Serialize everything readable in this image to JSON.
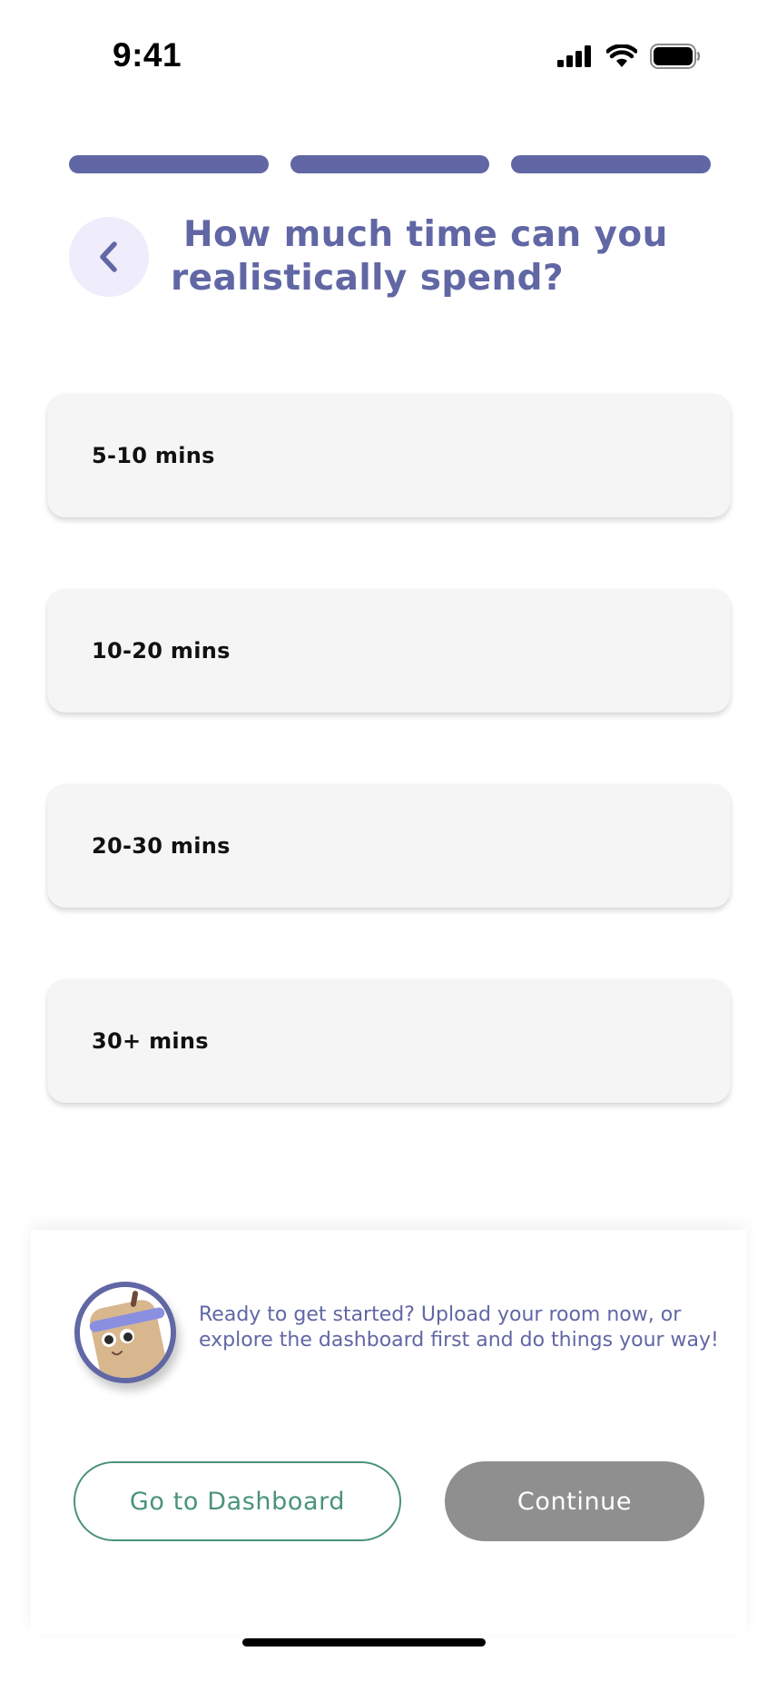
{
  "status_bar": {
    "time": "9:41",
    "icons": [
      "signal-icon",
      "wifi-icon",
      "battery-icon"
    ]
  },
  "progress": {
    "completed_steps": 3,
    "total_steps": 3,
    "color": "#6167a4"
  },
  "header": {
    "back_icon": "chevron-left-icon",
    "title_line1": "How much time can you",
    "title_line2": "realistically spend?"
  },
  "options": [
    {
      "label": "5-10 mins"
    },
    {
      "label": "10-20 mins"
    },
    {
      "label": "20-30 mins"
    },
    {
      "label": "30+ mins"
    }
  ],
  "panel": {
    "avatar_icon": "mascot-avatar-icon",
    "message_line1": "Ready to get started? Upload your room now, or",
    "message_line2": "explore the dashboard first and do things your way!",
    "dashboard_button": "Go to Dashboard",
    "continue_button": "Continue"
  },
  "colors": {
    "accent": "#6167a4",
    "back_button_bg": "#efecfc",
    "option_bg": "#f5f5f5",
    "dashboard_green": "#4a9379",
    "continue_disabled": "#8f8f8f"
  }
}
